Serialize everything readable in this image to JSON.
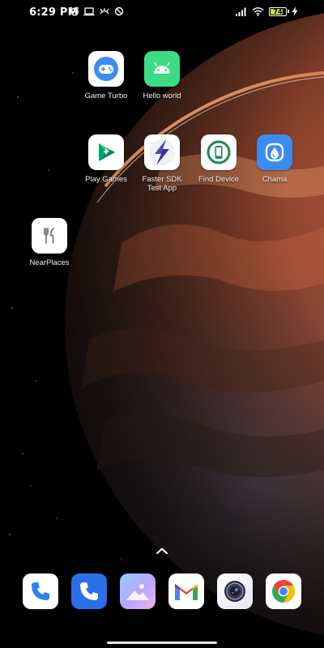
{
  "status_bar": {
    "time": "6:29 PM",
    "left_icons": [
      "alarm-icon",
      "screen-cast-icon",
      "vpn-key-icon",
      "do-not-disturb-icon"
    ],
    "right_icons": [
      "signal-icon",
      "wifi-icon",
      "battery-icon",
      "charging-icon"
    ],
    "battery_level": "74",
    "battery_color": "#c5e62a"
  },
  "home_apps": [
    {
      "label": "Game Turbo",
      "icon": "game-turbo-icon"
    },
    {
      "label": "Hello world",
      "icon": "android-icon"
    },
    {
      "label": "Play Games",
      "icon": "play-games-icon"
    },
    {
      "label": "Faster SDK\nTest App",
      "icon": "lightning-icon"
    },
    {
      "label": "Find Device",
      "icon": "find-device-icon"
    },
    {
      "label": "Chama",
      "icon": "water-drop-icon"
    },
    {
      "label": "NearPlaces",
      "icon": "fork-knife-icon"
    }
  ],
  "dock": {
    "apps": [
      {
        "icon": "phone-icon"
      },
      {
        "icon": "dialer-icon"
      },
      {
        "icon": "gallery-icon"
      },
      {
        "icon": "gmail-icon"
      },
      {
        "icon": "camera-icon"
      },
      {
        "icon": "chrome-icon"
      }
    ],
    "swipe_up_icon": "chevron-up-icon"
  }
}
